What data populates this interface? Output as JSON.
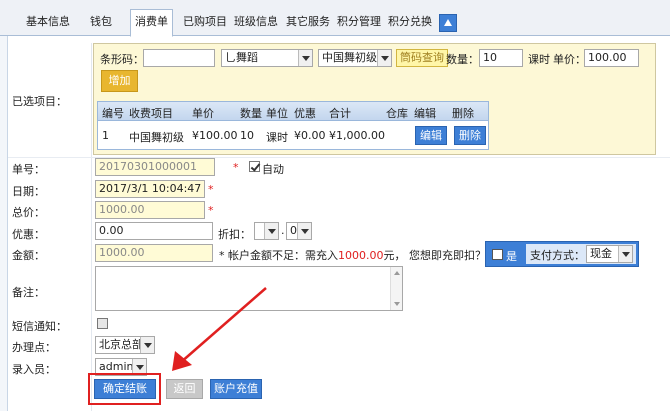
{
  "tabs": [
    {
      "label": "基本信息"
    },
    {
      "label": "钱包"
    },
    {
      "label": "消费单"
    },
    {
      "label": "已购项目"
    },
    {
      "label": "班级信息"
    },
    {
      "label": "其它服务"
    },
    {
      "label": "积分管理"
    },
    {
      "label": "积分兑换"
    }
  ],
  "items_section": {
    "label": "已选项目：",
    "barcode_label": "条形码：",
    "barcode_value": "",
    "category_select": "乚舞蹈",
    "course_select": "中国舞初级",
    "query_button": "筒码查询",
    "qty_label": "数量：",
    "qty_value": "10",
    "unit_label": "课时",
    "price_label": "单价：",
    "price_value": "100.00",
    "add_button": "增加",
    "table": {
      "headers": [
        "编号",
        "收费项目",
        "单价",
        "数量",
        "单位",
        "优惠",
        "合计",
        "仓库",
        "编辑",
        "删除"
      ],
      "rows": [
        {
          "no": "1",
          "item": "中国舞初级",
          "price": "¥100.00",
          "qty": "10",
          "unit": "课时",
          "discount": "¥0.00",
          "total": "¥1,000.00",
          "warehouse": "",
          "edit": "编辑",
          "delete": "删除"
        }
      ]
    }
  },
  "form": {
    "order_no_label": "单号：",
    "order_no_value": "20170301000001",
    "auto_label": "自动",
    "date_label": "日期：",
    "date_value": "2017/3/1 10:04:47",
    "total_label": "总价：",
    "total_value": "1000.00",
    "discount_label": "优惠：",
    "discount_value": "0.00",
    "rebate_label": "折扣：",
    "rebate_whole": "",
    "rebate_dot": ".",
    "rebate_decimal": "0",
    "amount_label": "金额：",
    "amount_value": "1000.00",
    "warning_prefix": "* 帐户金额不足：需充入",
    "warning_amount": "1000.00",
    "warning_suffix": "元，  您想即充即扣？",
    "yes_label": "是",
    "pay_label": "支付方式：",
    "pay_value": "现金",
    "remark_label": "备注：",
    "sms_label": "短信通知：",
    "office_label": "办理点：",
    "office_value": "北京总部",
    "operator_label": "录入员：",
    "operator_value": "admin",
    "required_mark": "*"
  },
  "buttons": {
    "confirm": "确定结账",
    "back": "返回",
    "recharge": "账户充值"
  },
  "colors": {
    "accent_blue": "#3d7fd6",
    "highlight_red": "#e02020",
    "panel_yellow": "#fdf8d6",
    "add_button_orange": "#e8b62f"
  }
}
